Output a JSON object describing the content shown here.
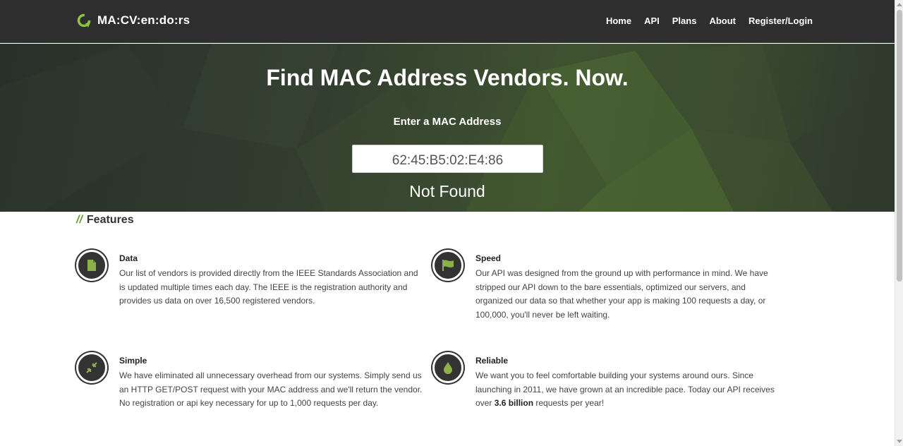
{
  "brand": {
    "name": "MA:CV:en:do:rs",
    "accent": "#8cc63f"
  },
  "nav": [
    "Home",
    "API",
    "Plans",
    "About",
    "Register/Login"
  ],
  "hero": {
    "title": "Find MAC Address Vendors. Now.",
    "input_label": "Enter a MAC Address",
    "input_value": "62:45:B5:02:E4:86",
    "result": "Not Found"
  },
  "features": {
    "heading_prefix": "//",
    "heading": "Features",
    "items": [
      {
        "title": "Data",
        "icon": "document-icon",
        "text": "Our list of vendors is provided directly from the IEEE Standards Association and is updated multiple times each day. The IEEE is the registration authority and provides us data on over 16,500 registered vendors."
      },
      {
        "title": "Speed",
        "icon": "flag-icon",
        "text": "Our API was designed from the ground up with performance in mind. We have stripped our API down to the bare essentials, optimized our servers, and organized our data so that whether your app is making 100 requests a day, or 100,000, you'll never be left waiting."
      },
      {
        "title": "Simple",
        "icon": "compress-icon",
        "text": "We have eliminated all unnecessary overhead from our systems. Simply send us an HTTP GET/POST request with your MAC address and we'll return the vendor. No registration or api key necessary for up to 1,000 requests per day."
      },
      {
        "title": "Reliable",
        "icon": "drop-icon",
        "text_before": "We want you to feel comfortable building your systems around ours. Since launching in 2011, we have grown at an incredible pace. Today our API receives over ",
        "text_bold": "3.6 billion",
        "text_after": " requests per year!"
      }
    ]
  }
}
